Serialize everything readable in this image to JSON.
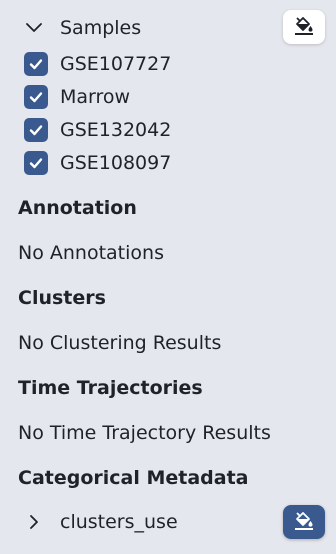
{
  "samples": {
    "label": "Samples",
    "items": [
      {
        "label": "GSE107727",
        "checked": true
      },
      {
        "label": "Marrow",
        "checked": true
      },
      {
        "label": "GSE132042",
        "checked": true
      },
      {
        "label": "GSE108097",
        "checked": true
      }
    ]
  },
  "annotation": {
    "title": "Annotation",
    "text": "No Annotations"
  },
  "clusters": {
    "title": "Clusters",
    "text": "No Clustering Results"
  },
  "time_trajectories": {
    "title": "Time Trajectories",
    "text": "No Time Trajectory Results"
  },
  "categorical_metadata": {
    "title": "Categorical Metadata",
    "items": [
      {
        "label": "clusters_use"
      }
    ]
  },
  "icons": {
    "paint_bucket": "paint-bucket-icon",
    "chevron_down": "chevron-down-icon",
    "chevron_right": "chevron-right-icon",
    "check": "check-icon"
  },
  "colors": {
    "background": "#e5e7ee",
    "accent": "#3a5a8f",
    "text": "#1f2329"
  }
}
